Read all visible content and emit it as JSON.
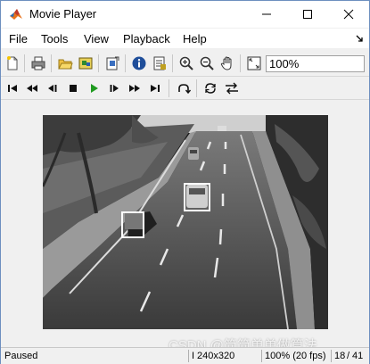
{
  "window": {
    "title": "Movie Player"
  },
  "menu": [
    "File",
    "Tools",
    "View",
    "Playback",
    "Help"
  ],
  "toolbar": {
    "zoom_value": "100%"
  },
  "status": {
    "state": "Paused",
    "frame_type": "I",
    "resolution": "240x320",
    "zoom_fps": "100% (20 fps)",
    "frame_pos": "18",
    "frame_total": "41"
  },
  "watermark": "CSDN @简简单单做算法",
  "icons": {
    "toolbar1": [
      "new-icon",
      "print-icon",
      "open-folder-icon",
      "connect-icon",
      "export-icon",
      "info-icon",
      "properties-icon",
      "zoom-in-icon",
      "zoom-out-icon",
      "pan-hand-icon",
      "fit-to-window-icon"
    ],
    "toolbar2": [
      "go-to-first-icon",
      "rewind-icon",
      "step-back-icon",
      "stop-icon",
      "play-icon",
      "step-forward-icon",
      "fast-forward-icon",
      "go-to-last-icon",
      "loop-icon",
      "repeat-icon",
      "swap-icon"
    ]
  },
  "colors": {
    "play_icon": "#1f9a1f",
    "title_bar": "#ffffff",
    "window_border": "#6d8fbf"
  }
}
